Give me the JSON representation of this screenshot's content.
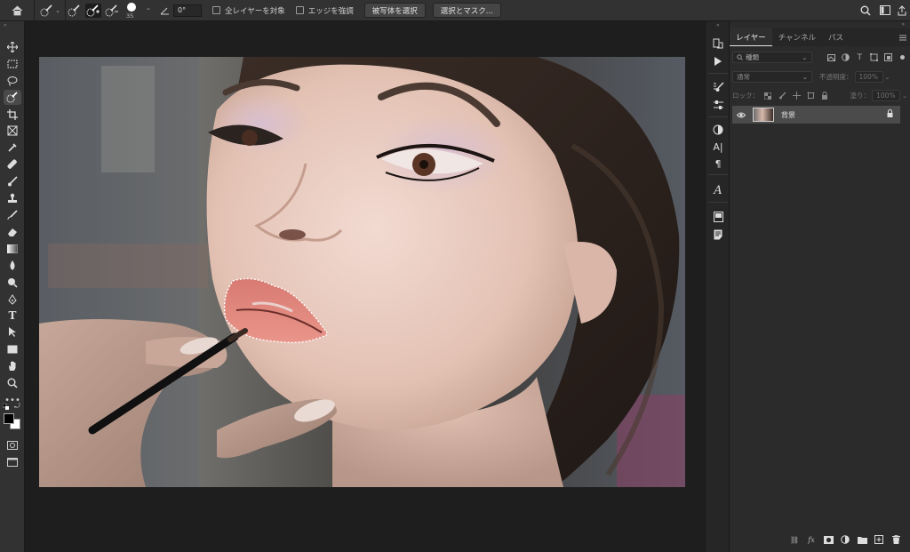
{
  "options_bar": {
    "brush_size": "35",
    "angle_value": "0°",
    "sample_all_layers_label": "全レイヤーを対象",
    "enhance_edge_label": "エッジを強調",
    "select_subject_label": "被写体を選択",
    "select_and_mask_label": "選択とマスク..."
  },
  "layers_panel": {
    "tabs": [
      "レイヤー",
      "チャンネル",
      "パス"
    ],
    "filter_kind": "種類",
    "blend_mode": "通常",
    "opacity_label": "不透明度：",
    "opacity_value": "100%",
    "lock_label": "ロック：",
    "fill_label": "塗り：",
    "fill_value": "100%",
    "layers": [
      {
        "name": "背景",
        "visible": true,
        "locked": true
      }
    ]
  },
  "colors": {
    "foreground": "#000000",
    "background": "#ffffff",
    "ui_dark": "#323232",
    "panel": "#2b2b2b"
  },
  "icons": {
    "left_toolbar": [
      "move-icon",
      "marquee-icon",
      "lasso-icon",
      "quick-selection-icon",
      "crop-icon",
      "frame-icon",
      "eyedropper-icon",
      "healing-brush-icon",
      "brush-icon",
      "clone-stamp-icon",
      "history-brush-icon",
      "eraser-icon",
      "gradient-icon",
      "blur-icon",
      "dodge-icon",
      "pen-icon",
      "type-icon",
      "path-selection-icon",
      "rectangle-icon",
      "hand-icon",
      "zoom-icon",
      "more-tools-icon"
    ],
    "panel_strip": [
      "history-icon",
      "actions-icon",
      "brush-settings-icon",
      "adjustments-icon",
      "color-icon",
      "character-icon",
      "paragraph-icon",
      "glyphs-icon",
      "libraries-icon",
      "notes-icon"
    ]
  }
}
